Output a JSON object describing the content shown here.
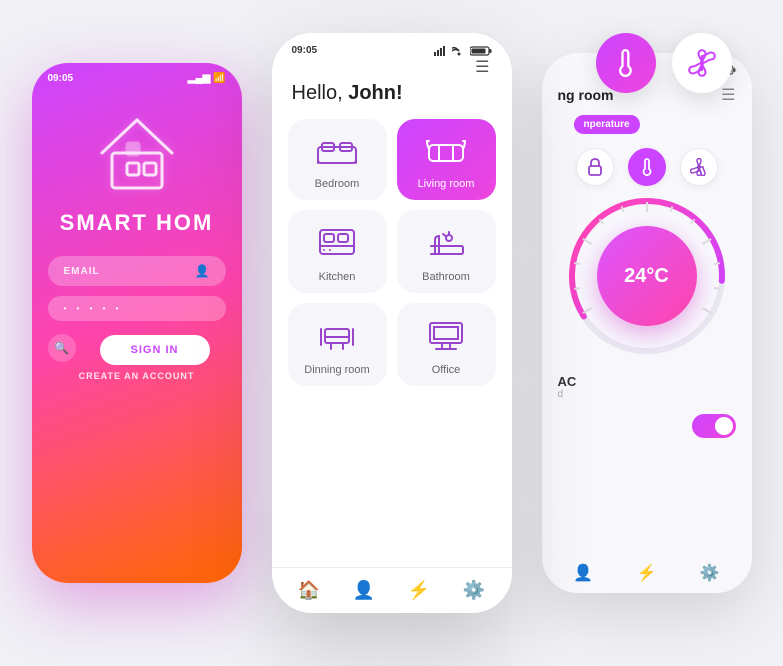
{
  "scene": {
    "floating": {
      "thermometer_icon": "🌡️",
      "fan_icon": "💠"
    },
    "phone_left": {
      "status_time": "09:05",
      "brand": "SMART HOM",
      "email_label": "EMAIL",
      "password_dots": "• • • • •",
      "sign_in_label": "SIGN IN",
      "create_account_label": "CREATE AN ACCOUNT"
    },
    "phone_center": {
      "status_time": "09:05",
      "greeting_pre": "Hello, ",
      "greeting_name": "John!",
      "rooms": [
        {
          "id": "bedroom",
          "label": "Bedroom",
          "icon": "🛏️",
          "active": false
        },
        {
          "id": "living-room",
          "label": "Living room",
          "icon": "🛋️",
          "active": true
        },
        {
          "id": "kitchen",
          "label": "Kitchen",
          "icon": "🍳",
          "active": false
        },
        {
          "id": "bathroom",
          "label": "Bathroom",
          "icon": "🛁",
          "active": false
        },
        {
          "id": "dinning-room",
          "label": "Dinning room",
          "icon": "🪑",
          "active": false
        },
        {
          "id": "office",
          "label": "Office",
          "icon": "🖥️",
          "active": false
        }
      ],
      "nav_items": [
        "🏠",
        "👤",
        "⚡",
        "⚙️"
      ]
    },
    "phone_right": {
      "room_title": "ng room",
      "temp_badge_label": "nperature",
      "temp_value": "24°C",
      "controls": [
        "🔒",
        "🌡️",
        "💠"
      ],
      "ac_label": "AC",
      "ac_sub": "d",
      "nav_items": [
        "👤",
        "⚡",
        "⚙️"
      ]
    }
  }
}
